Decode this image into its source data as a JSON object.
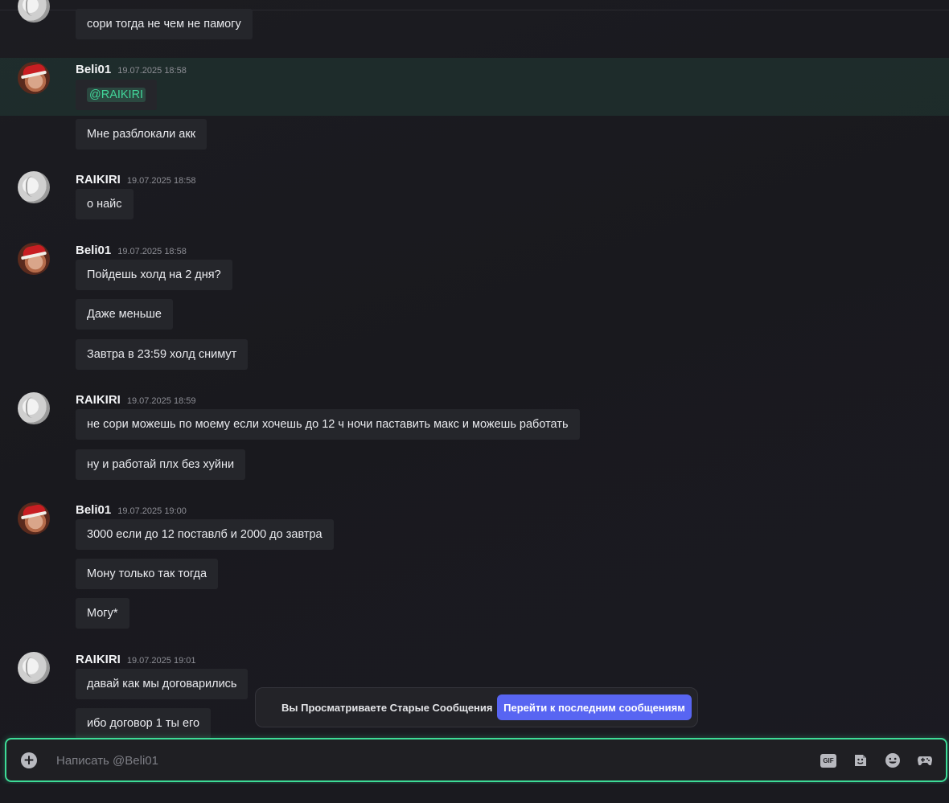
{
  "messages": [
    {
      "author": "",
      "time": "",
      "lines": [
        "сори тогда  не чем не памогу"
      ]
    },
    {
      "author": "Beli01",
      "time": "19.07.2025 18:58",
      "mention": "@RAIKIRI",
      "lines": [
        "Мне разблокали акк"
      ]
    },
    {
      "author": "RAIKIRI",
      "time": "19.07.2025 18:58",
      "lines": [
        "о найс"
      ]
    },
    {
      "author": "Beli01",
      "time": "19.07.2025 18:58",
      "lines": [
        "Пойдешь холд на 2 дня?",
        "Даже меньше",
        "Завтра в 23:59 холд снимут"
      ]
    },
    {
      "author": "RAIKIRI",
      "time": "19.07.2025 18:59",
      "lines": [
        "не сори можешь по моему если хочешь до 12 ч ночи паставить макс и можешь работать",
        "ну и работай плх без хуйни"
      ]
    },
    {
      "author": "Beli01",
      "time": "19.07.2025 19:00",
      "lines": [
        "3000 если до 12 поставлб и 2000 до завтра",
        "Мону только так тогда",
        "Могу*"
      ]
    },
    {
      "author": "RAIKIRI",
      "time": "19.07.2025 19:01",
      "lines": [
        "давай как мы договарились",
        "ибо договор 1 ты его"
      ]
    }
  ],
  "toast": {
    "text": "Вы Просматриваете Старые Сообщения",
    "button": "Перейти к последним сообщениям"
  },
  "composer": {
    "placeholder": "Написать @Beli01",
    "value": ""
  },
  "icons": [
    "plus-circle-icon",
    "gif-icon",
    "sticker-icon",
    "emoji-icon",
    "game-controller-icon"
  ],
  "colors": {
    "accent": "#5865f2",
    "focus": "#3ddc97",
    "mention": "#42d69a"
  }
}
